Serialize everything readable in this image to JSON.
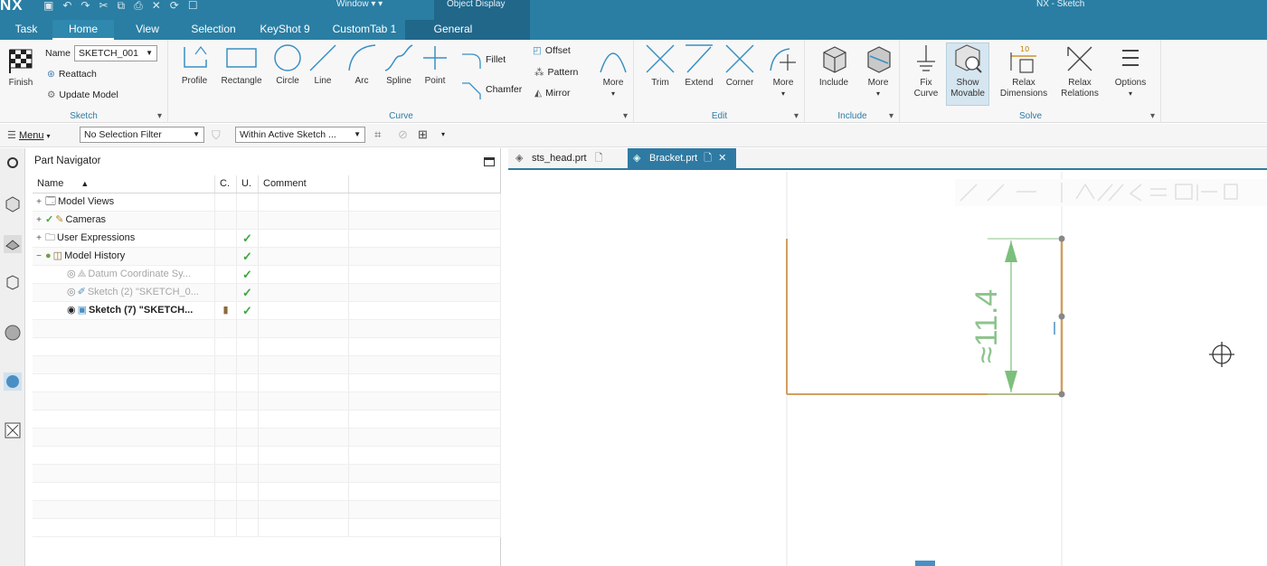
{
  "app": {
    "brand": "NX",
    "window_menu": "Window ▾ ▾",
    "object_display": "Object Display",
    "title": "NX - Sketch"
  },
  "ribbon_tabs": [
    {
      "label": "Task",
      "active": false
    },
    {
      "label": "Home",
      "active": true
    },
    {
      "label": "View",
      "active": false
    },
    {
      "label": "Selection",
      "active": false
    },
    {
      "label": "KeyShot 9",
      "active": false
    },
    {
      "label": "CustomTab 1",
      "active": false
    },
    {
      "label": "General",
      "active": false
    }
  ],
  "sketch_group": {
    "finish": "Finish",
    "name_label": "Name",
    "name_value": "SKETCH_001",
    "reattach": "Reattach",
    "update_model": "Update Model",
    "label": "Sketch"
  },
  "curve_group": {
    "tools": [
      "Profile",
      "Rectangle",
      "Circle",
      "Line",
      "Arc",
      "Spline",
      "Point"
    ],
    "fillet": "Fillet",
    "chamfer": "Chamfer",
    "offset": "Offset",
    "pattern": "Pattern",
    "mirror": "Mirror",
    "more": "More",
    "label": "Curve"
  },
  "edit_group": {
    "tools": [
      "Trim",
      "Extend",
      "Corner"
    ],
    "more": "More",
    "label": "Edit"
  },
  "include_group": {
    "include": "Include",
    "more": "More",
    "label": "Include"
  },
  "solve_group": {
    "fix_curve": "Fix Curve",
    "show_movable": "Show Movable",
    "relax_dimensions": "Relax Dimensions",
    "relax_relations": "Relax Relations",
    "options": "Options",
    "label": "Solve",
    "relax_dim_badge": "10"
  },
  "cmdbar": {
    "menu": "Menu",
    "selection_filter": "No Selection Filter",
    "scope": "Within Active Sketch ..."
  },
  "navigator": {
    "title": "Part Navigator",
    "columns": [
      "Name",
      "C.",
      "U.",
      "Comment"
    ],
    "rows": [
      {
        "name": "Model Views",
        "uptodate": ""
      },
      {
        "name": "Cameras",
        "uptodate": ""
      },
      {
        "name": "User Expressions",
        "uptodate": "✓"
      },
      {
        "name": "Model History",
        "uptodate": "✓"
      },
      {
        "name": "Datum Coordinate Sy...",
        "uptodate": "✓"
      },
      {
        "name": "Sketch (2) \"SKETCH_0...",
        "uptodate": "✓"
      },
      {
        "name": "Sketch (7) \"SKETCH...",
        "uptodate": "✓"
      }
    ]
  },
  "doc_tabs": [
    {
      "label": "sts_head.prt",
      "active": false
    },
    {
      "label": "Bracket.prt",
      "active": true
    }
  ],
  "sketch": {
    "dimension_text": "≈11.4"
  }
}
